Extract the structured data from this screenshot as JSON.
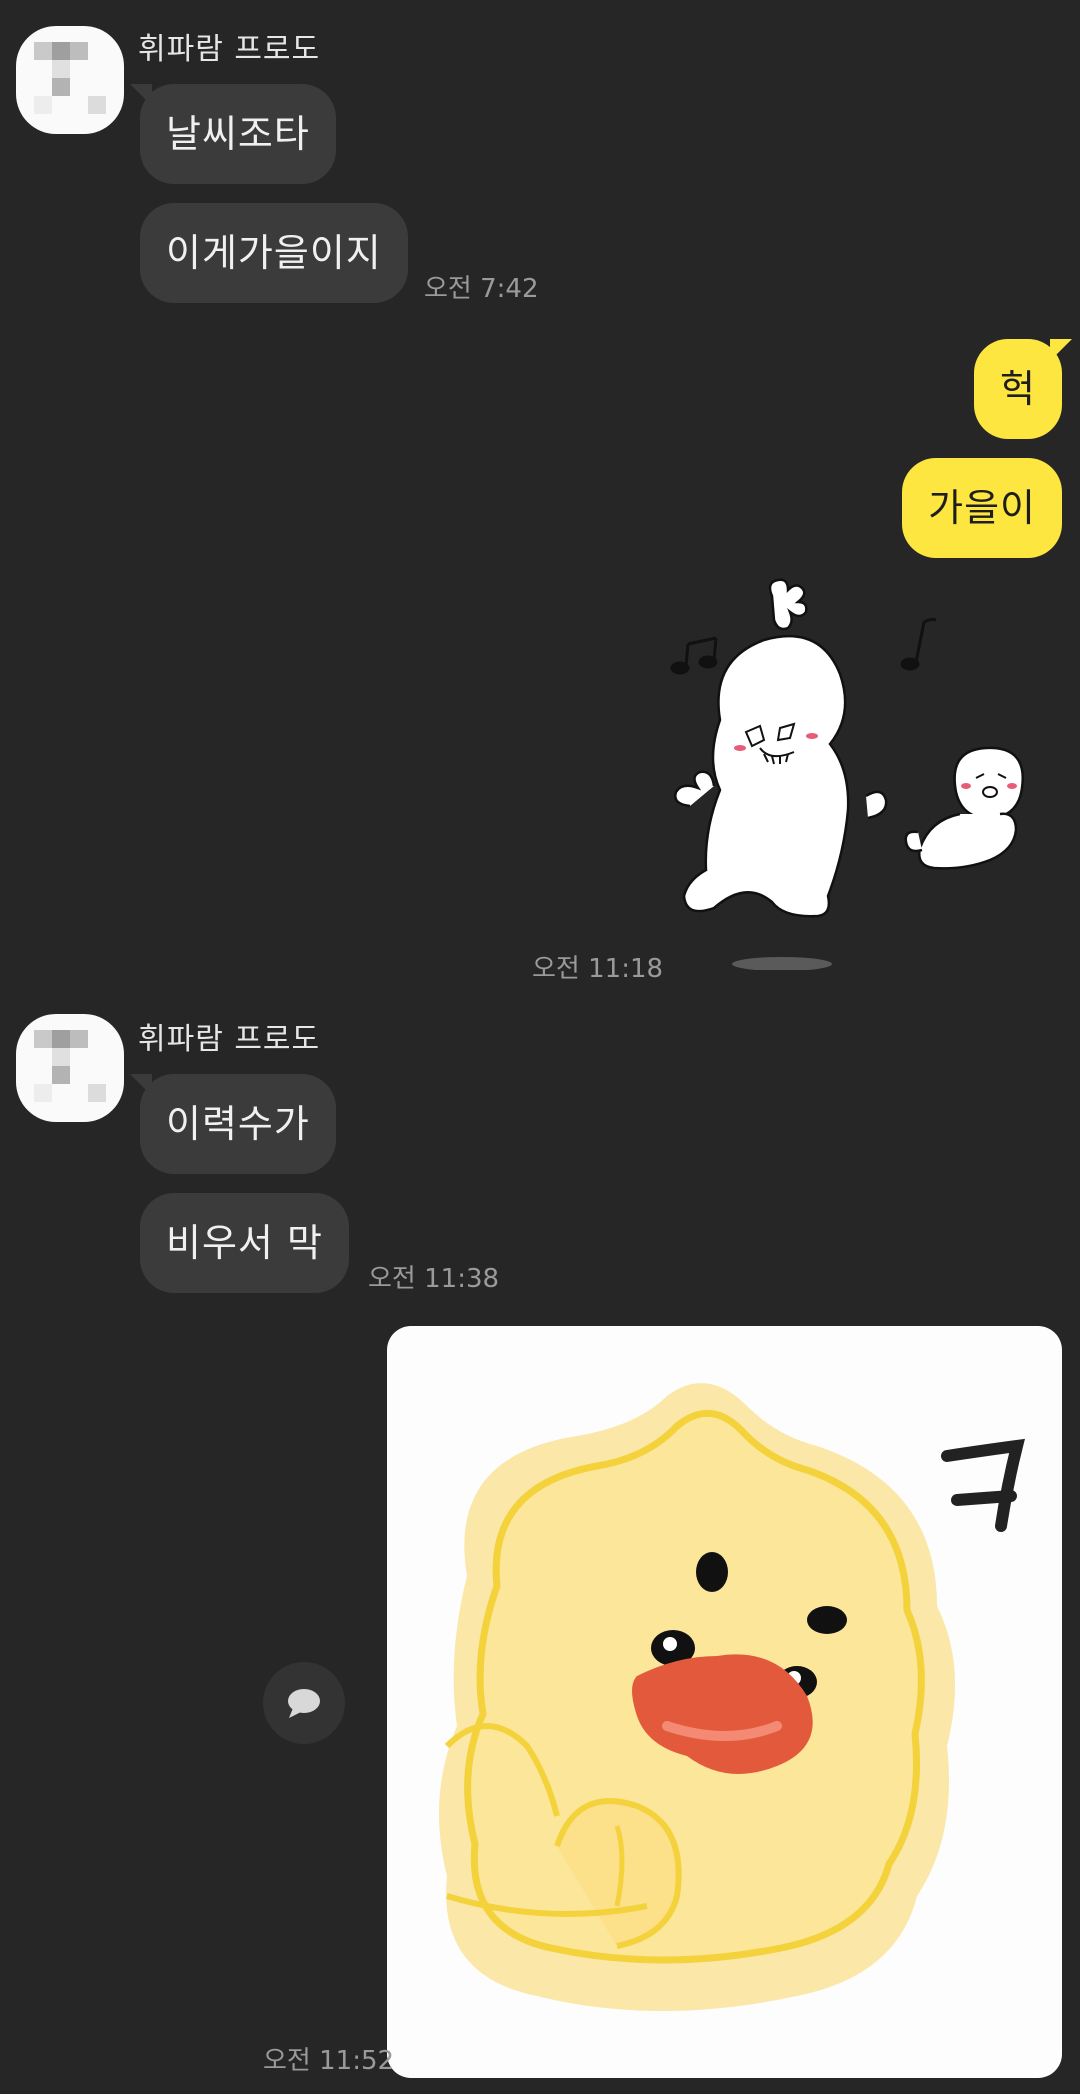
{
  "chat": {
    "group1": {
      "sender": "휘파람 프로도",
      "messages": [
        "날씨조타",
        "이게가을이지"
      ],
      "time": "오전 7:42"
    },
    "my_group1": {
      "messages": [
        "헉",
        "가을이"
      ],
      "sticker_time": "오전 11:18"
    },
    "group2": {
      "sender": "휘파람 프로도",
      "messages": [
        "이력수가",
        "비우서 막"
      ],
      "time": "오전 11:38"
    },
    "my_group2": {
      "sticker_text": "ㅋ",
      "sticker_time": "오전 11:52"
    }
  },
  "colors": {
    "background": "#262626",
    "incoming_bubble": "#3b3b3b",
    "outgoing_bubble": "#fee640",
    "timestamp": "#9a9a9a"
  },
  "icons": {
    "reply": "speech-bubble-icon"
  }
}
